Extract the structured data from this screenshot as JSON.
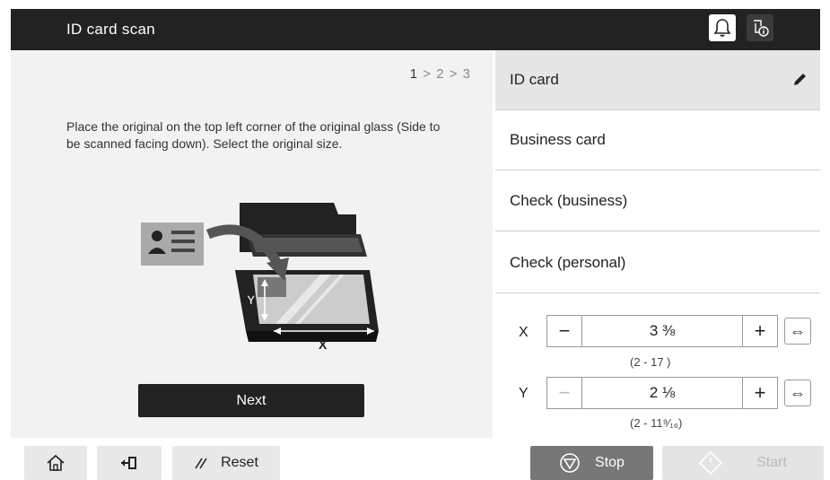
{
  "header": {
    "title": "ID card scan"
  },
  "steps": {
    "current": "1",
    "sep1": ">",
    "s2": "2",
    "sep2": ">",
    "s3": "3"
  },
  "instructions": "Place the original on the top left corner of the original glass (Side to be scanned facing down). Select the original size.",
  "illustration": {
    "x_label": "X",
    "y_label": "Y"
  },
  "next_label": "Next",
  "options": [
    {
      "label": "ID card",
      "selected": true
    },
    {
      "label": "Business card",
      "selected": false
    },
    {
      "label": "Check (business)",
      "selected": false
    },
    {
      "label": "Check (personal)",
      "selected": false
    }
  ],
  "size": {
    "x": {
      "label": "X",
      "value": "3 ⅜",
      "range": "(2   - 17   )",
      "minus": "−",
      "plus": "+",
      "swap": "⇔"
    },
    "y": {
      "label": "Y",
      "value": "2 ⅛",
      "range": "(2   - 11⁹⁄₁₆)",
      "minus": "−",
      "plus": "+",
      "swap": "⇔"
    }
  },
  "footer": {
    "reset_label": "Reset",
    "stop_label": "Stop",
    "start_label": "Start"
  },
  "colors": {
    "header_bg": "#222222",
    "panel_bg": "#f2f2f2",
    "selected_bg": "#e6e6e6",
    "stop_bg": "#777777"
  }
}
